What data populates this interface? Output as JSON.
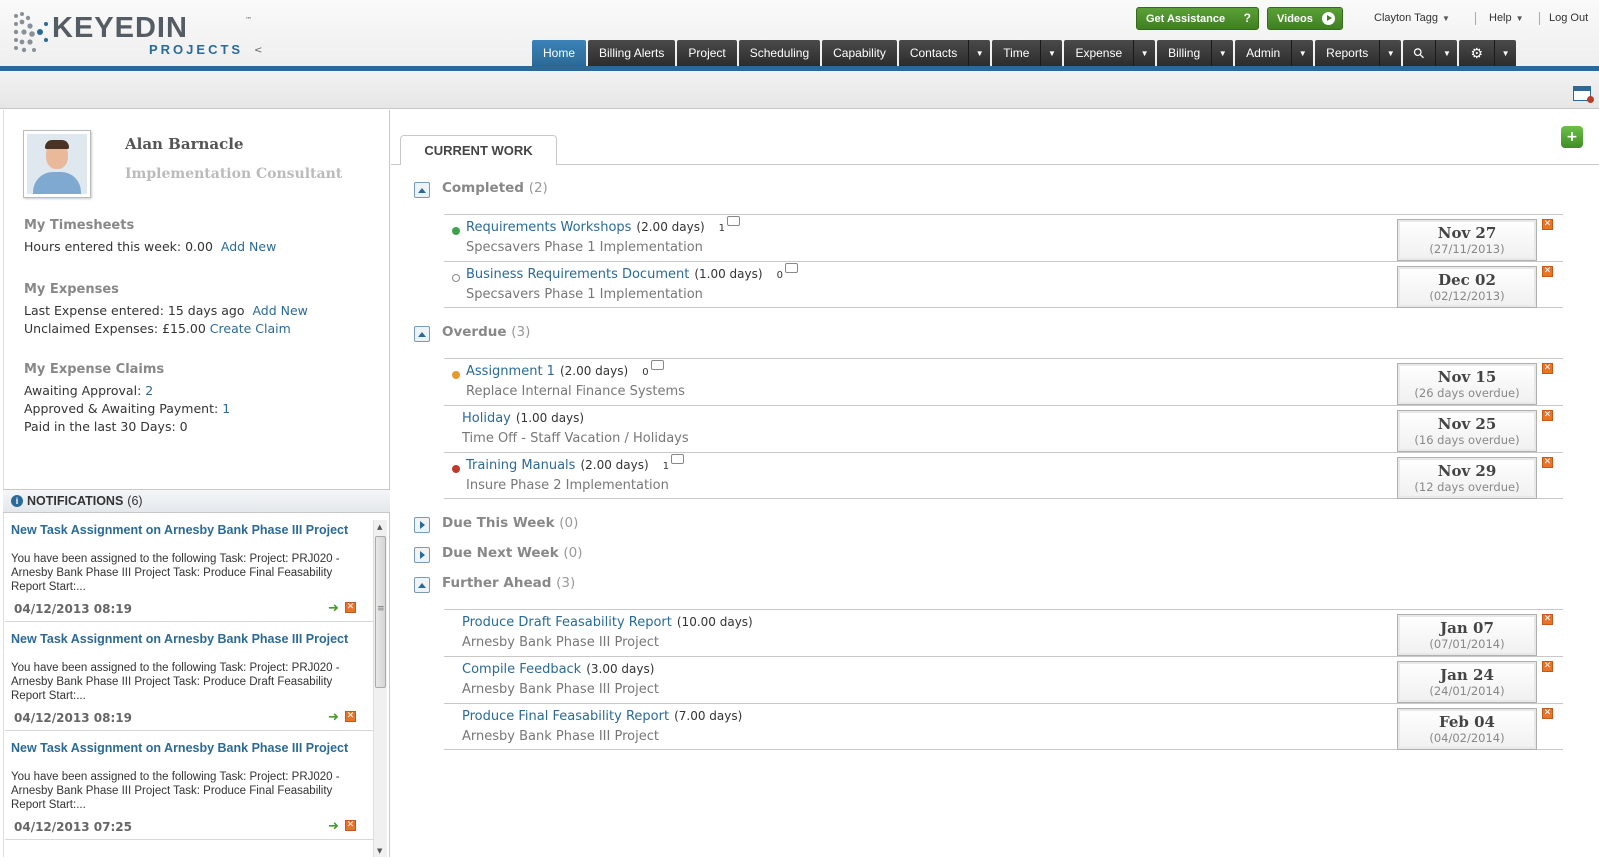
{
  "header": {
    "logo_word": "KEYEDIN",
    "logo_sub": "PROJECTS",
    "logo_tm": "™",
    "collapse_glyph": "<",
    "assist_label": "Get Assistance",
    "assist_icon": "?",
    "videos_label": "Videos",
    "user_name": "Clayton Tagg",
    "help_label": "Help",
    "logout_label": "Log Out"
  },
  "nav": {
    "tabs": [
      {
        "label": "Home",
        "active": true,
        "split": false
      },
      {
        "label": "Billing Alerts",
        "active": false,
        "split": false
      },
      {
        "label": "Project",
        "active": false,
        "split": false
      },
      {
        "label": "Scheduling",
        "active": false,
        "split": false
      },
      {
        "label": "Capability",
        "active": false,
        "split": false
      },
      {
        "label": "Contacts",
        "active": false,
        "split": true
      },
      {
        "label": "Time",
        "active": false,
        "split": true
      },
      {
        "label": "Expense",
        "active": false,
        "split": true
      },
      {
        "label": "Billing",
        "active": false,
        "split": true
      },
      {
        "label": "Admin",
        "active": false,
        "split": true
      },
      {
        "label": "Reports",
        "active": false,
        "split": true
      }
    ],
    "search_icon": "search-icon",
    "settings_icon": "gear-icon"
  },
  "profile": {
    "name": "Alan Barnacle",
    "role": "Implementation Consultant"
  },
  "timesheets": {
    "title": "My Timesheets",
    "hours_text": "Hours entered this week: 0.00",
    "add_new": "Add New"
  },
  "expenses": {
    "title": "My Expenses",
    "last_text": "Last Expense entered: 15 days ago",
    "add_new": "Add New",
    "unclaimed_text": "Unclaimed Expenses: £15.00",
    "create_claim": "Create Claim"
  },
  "claims": {
    "title": "My Expense Claims",
    "awaiting_label": "Awaiting Approval:",
    "awaiting_value": "2",
    "approved_label": "Approved & Awaiting Payment:",
    "approved_value": "1",
    "paid_text": "Paid in the last 30 Days: 0"
  },
  "notifications": {
    "title": "NOTIFICATIONS",
    "count": "(6)",
    "items": [
      {
        "title": "New Task Assignment on Arnesby Bank Phase III Project",
        "body": "You have been assigned to the following Task:  Project: PRJ020 - Arnesby Bank Phase III Project Task: Produce Final Feasability Report Start:...",
        "date": "04/12/2013 08:19"
      },
      {
        "title": "New Task Assignment on Arnesby Bank Phase III Project",
        "body": "You have been assigned to the following Task:  Project: PRJ020 - Arnesby Bank Phase III Project Task: Produce Draft Feasability Report Start:...",
        "date": "04/12/2013 08:19"
      },
      {
        "title": "New Task Assignment on Arnesby Bank Phase III Project",
        "body": "You have been assigned to the following Task:  Project: PRJ020 - Arnesby Bank Phase III Project Task: Produce Final Feasability Report Start:...",
        "date": "04/12/2013 07:25"
      }
    ]
  },
  "current_work": {
    "tab_label": "CURRENT WORK",
    "add_glyph": "+",
    "groups": [
      {
        "title": "Completed",
        "count": "(2)",
        "expanded": true,
        "items": [
          {
            "name": "Requirements Workshops",
            "days": "(2.00 days)",
            "comments": "1",
            "project": "Specsavers Phase 1 Implementation",
            "date_main": "Nov 27",
            "date_sub": "(27/11/2013)",
            "status": "complete",
            "status_color": "#3fa34d"
          },
          {
            "name": "Business Requirements Document",
            "days": "(1.00 days)",
            "comments": "0",
            "project": "Specsavers Phase 1 Implementation",
            "date_main": "Dec 02",
            "date_sub": "(02/12/2013)",
            "status": "open",
            "status_color": "#888888"
          }
        ]
      },
      {
        "title": "Overdue",
        "count": "(3)",
        "expanded": true,
        "items": [
          {
            "name": "Assignment 1",
            "days": "(2.00 days)",
            "comments": "0",
            "project": "Replace Internal Finance Systems",
            "date_main": "Nov 15",
            "date_sub": "(26 days overdue)",
            "status": "warning",
            "status_color": "#e59a2f"
          },
          {
            "name": "Holiday",
            "days": "(1.00 days)",
            "comments": "",
            "project": "Time Off - Staff Vacation / Holidays",
            "date_main": "Nov 25",
            "date_sub": "(16 days overdue)",
            "status": "none",
            "status_color": ""
          },
          {
            "name": "Training Manuals",
            "days": "(2.00 days)",
            "comments": "1",
            "project": "Insure Phase 2 Implementation",
            "date_main": "Nov 29",
            "date_sub": "(12 days overdue)",
            "status": "late",
            "status_color": "#c0392b"
          }
        ]
      },
      {
        "title": "Due This Week",
        "count": "(0)",
        "expanded": false,
        "items": []
      },
      {
        "title": "Due Next Week",
        "count": "(0)",
        "expanded": false,
        "items": []
      },
      {
        "title": "Further Ahead",
        "count": "(3)",
        "expanded": true,
        "items": [
          {
            "name": "Produce Draft Feasability Report",
            "days": "(10.00 days)",
            "comments": "",
            "project": "Arnesby Bank Phase III Project",
            "date_main": "Jan 07",
            "date_sub": "(07/01/2014)",
            "status": "none",
            "status_color": ""
          },
          {
            "name": "Compile Feedback",
            "days": "(3.00 days)",
            "comments": "",
            "project": "Arnesby Bank Phase III Project",
            "date_main": "Jan 24",
            "date_sub": "(24/01/2014)",
            "status": "none",
            "status_color": ""
          },
          {
            "name": "Produce Final Feasability Report",
            "days": "(7.00 days)",
            "comments": "",
            "project": "Arnesby Bank Phase III Project",
            "date_main": "Feb 04",
            "date_sub": "(04/02/2014)",
            "status": "none",
            "status_color": ""
          }
        ]
      }
    ]
  }
}
